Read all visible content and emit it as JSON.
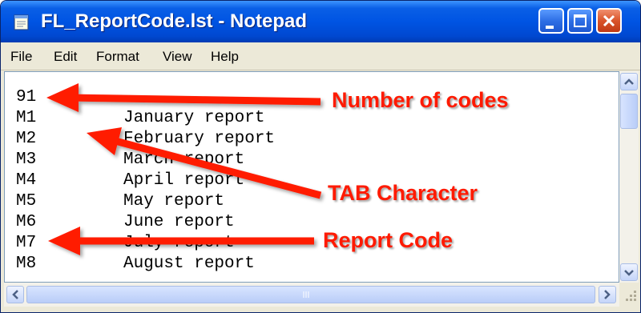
{
  "window": {
    "title": "FL_ReportCode.lst - Notepad",
    "app_icon": "notepad-icon",
    "controls": [
      "minimize-icon",
      "maximize-icon",
      "close-icon"
    ],
    "titlebar_color": "#0054E3",
    "close_color": "#D9532A"
  },
  "menu": [
    "File",
    "Edit",
    "Format",
    "View",
    "Help"
  ],
  "editor": {
    "lines": [
      {
        "code": "91",
        "desc": ""
      },
      {
        "code": "M1",
        "desc": "January report"
      },
      {
        "code": "M2",
        "desc": "February report"
      },
      {
        "code": "M3",
        "desc": "March report"
      },
      {
        "code": "M4",
        "desc": "April report"
      },
      {
        "code": "M5",
        "desc": "May report"
      },
      {
        "code": "M6",
        "desc": "June report"
      },
      {
        "code": "M7",
        "desc": "July report"
      },
      {
        "code": "M8",
        "desc": "August report"
      }
    ]
  },
  "annotations": {
    "number_of_codes": "Number of codes",
    "tab_character": "TAB Character",
    "report_code": "Report Code",
    "color": "#FF1A00"
  }
}
